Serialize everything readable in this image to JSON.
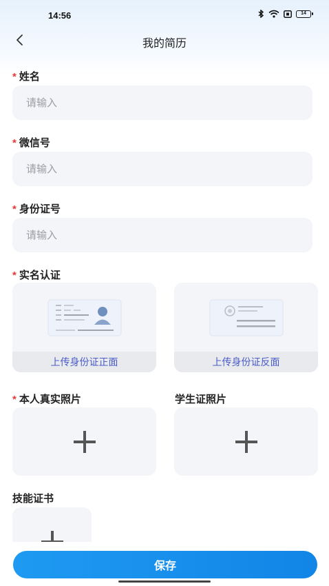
{
  "status_bar": {
    "time": "14:56",
    "battery": "14",
    "icons": [
      "bluetooth-icon",
      "wifi-icon",
      "sim-icon",
      "battery-icon"
    ]
  },
  "nav": {
    "title": "我的简历",
    "back_icon": "chevron-left-icon"
  },
  "form": {
    "name": {
      "required": "*",
      "label": "姓名",
      "placeholder": "请输入"
    },
    "wechat": {
      "required": "*",
      "label": "微信号",
      "placeholder": "请输入"
    },
    "id_number": {
      "required": "*",
      "label": "身份证号",
      "placeholder": "请输入"
    },
    "real_name": {
      "required": "*",
      "label": "实名认证",
      "front_caption": "上传身份证正面",
      "back_caption": "上传身份证反面"
    },
    "photos": {
      "personal": {
        "required": "*",
        "label": "本人真实照片"
      },
      "student": {
        "label": "学生证照片"
      }
    },
    "skill_cert": {
      "label": "技能证书"
    }
  },
  "actions": {
    "save_label": "保存"
  },
  "colors": {
    "accent": "#1e9af2",
    "required": "#e53935",
    "caption": "#4a5cc7",
    "input_bg": "#f4f5f8"
  }
}
